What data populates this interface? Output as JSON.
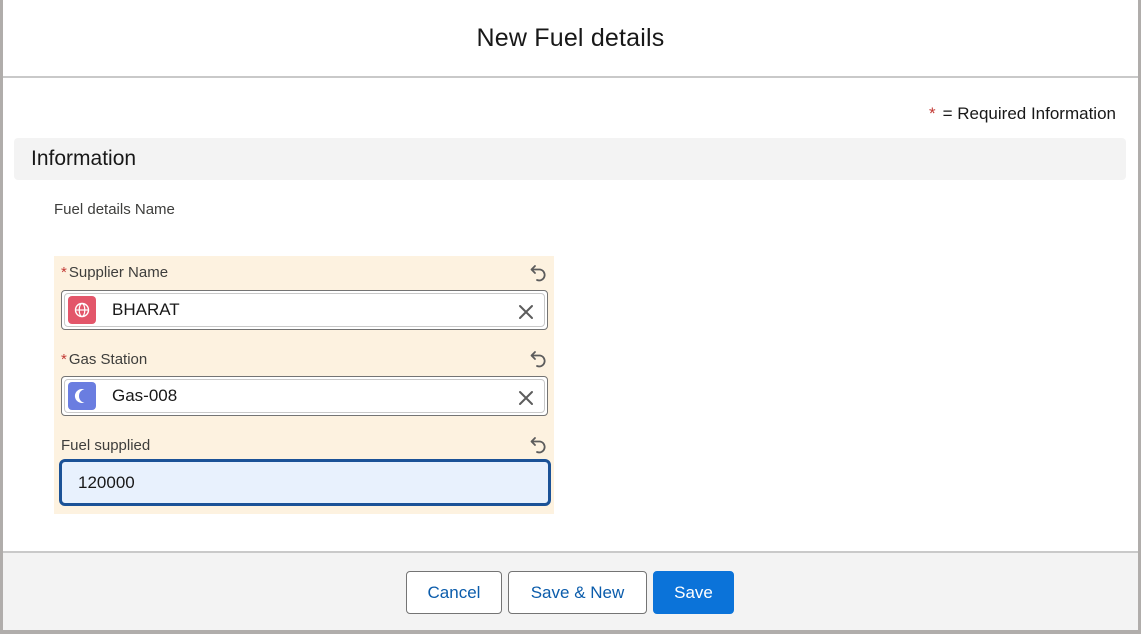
{
  "modal": {
    "title": "New Fuel details",
    "required_star": "*",
    "required_text": "= Required Information"
  },
  "section": {
    "title": "Information"
  },
  "fields": {
    "name": {
      "label": "Fuel details Name"
    },
    "supplier": {
      "required_mark": "*",
      "label": "Supplier Name",
      "value": "BHARAT",
      "icon": "globe-icon",
      "icon_color": "#e3566a"
    },
    "gas_station": {
      "required_mark": "*",
      "label": "Gas Station",
      "value": "Gas-008",
      "icon": "moon-icon",
      "icon_color": "#6a7de0"
    },
    "fuel_supplied": {
      "label": "Fuel supplied",
      "value": "120000"
    }
  },
  "footer": {
    "cancel_label": "Cancel",
    "save_new_label": "Save & New",
    "save_label": "Save"
  },
  "colors": {
    "brand": "#0b73d9",
    "edited_background": "#fdf2e0",
    "focus_border": "#1b5297",
    "required": "#c23934"
  }
}
